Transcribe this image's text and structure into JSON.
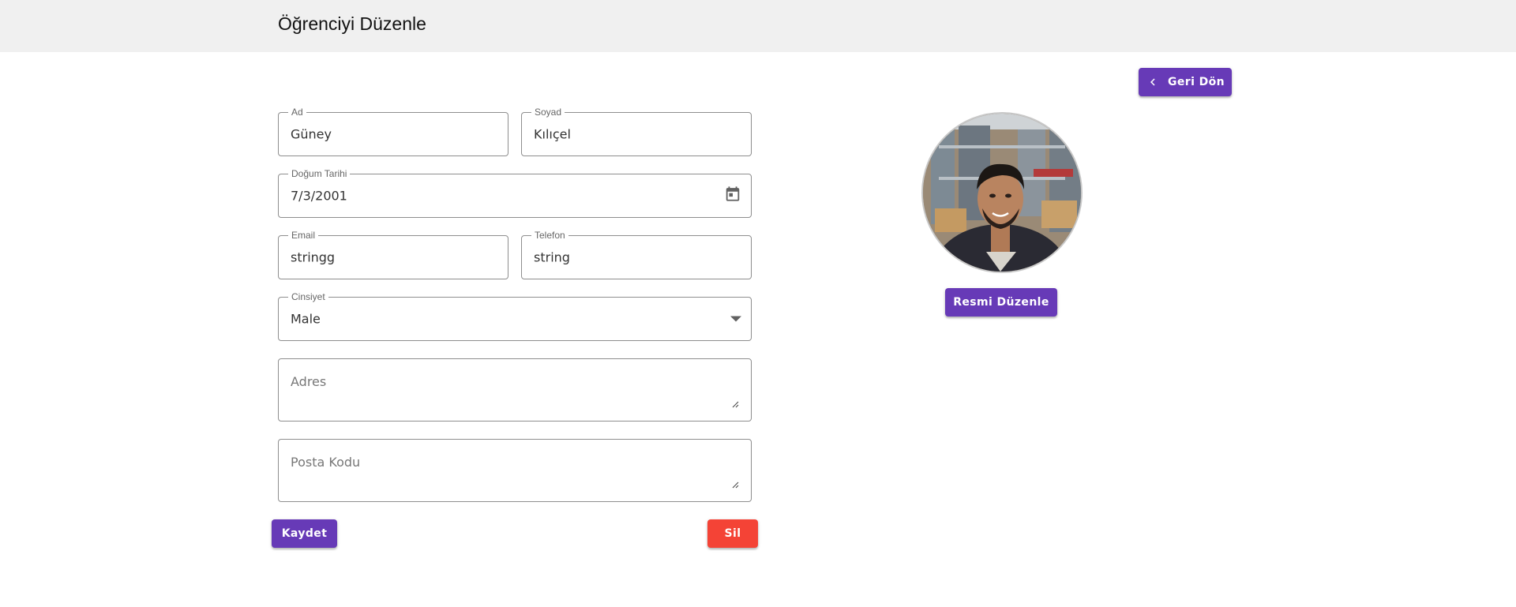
{
  "header": {
    "title": "Öğrenciyi Düzenle"
  },
  "back_button": {
    "label": "Geri Dön",
    "icon": "chevron-left-icon"
  },
  "form": {
    "first_name": {
      "label": "Ad",
      "value": "Güney"
    },
    "last_name": {
      "label": "Soyad",
      "value": "Kılıçel"
    },
    "birth_date": {
      "label": "Doğum Tarihi",
      "value": "7/3/2001",
      "icon": "calendar-icon"
    },
    "email": {
      "label": "Email",
      "value": "stringg"
    },
    "phone": {
      "label": "Telefon",
      "value": "string"
    },
    "gender": {
      "label": "Cinsiyet",
      "value": "Male",
      "icon": "dropdown-arrow-icon"
    },
    "address": {
      "placeholder": "Adres"
    },
    "postal_code": {
      "placeholder": "Posta Kodu"
    }
  },
  "actions": {
    "save_label": "Kaydet",
    "delete_label": "Sil"
  },
  "photo": {
    "edit_label": "Resmi Düzenle"
  },
  "colors": {
    "primary": "#673ab7",
    "danger": "#f44336",
    "header_bg": "#f0f0f0"
  }
}
